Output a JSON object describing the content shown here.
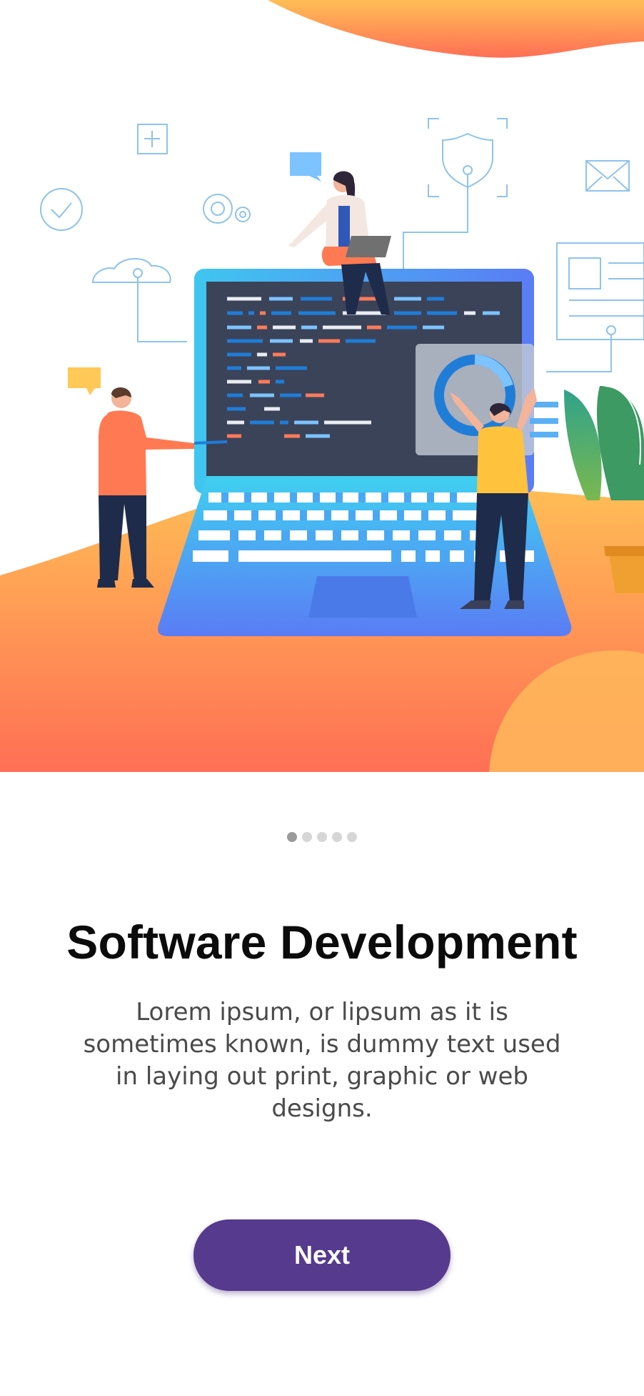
{
  "colors": {
    "hero_gradient_top": "#ffbe55",
    "hero_gradient_bottom": "#ff6f55",
    "screen": "#3b4359",
    "laptop": "#4aa8f2",
    "line_art": "#8ec3ec",
    "button": "#553a8e",
    "dot_active": "#9a9a9a",
    "dot_inactive": "#d6d6d6"
  },
  "illustration": {
    "icons": [
      "plus-icon",
      "check-circle-icon",
      "gear-icon",
      "chat-bubble-icon",
      "shield-icon",
      "envelope-icon",
      "cloud-icon",
      "document-icon",
      "chart-ring-icon",
      "plant-icon"
    ]
  },
  "pager": {
    "pages": 5,
    "active_index": 0
  },
  "content": {
    "title": "Software Development",
    "description": "Lorem ipsum, or lipsum as it is sometimes known, is dummy text used in laying out print, graphic or web designs."
  },
  "actions": {
    "next_label": "Next"
  }
}
